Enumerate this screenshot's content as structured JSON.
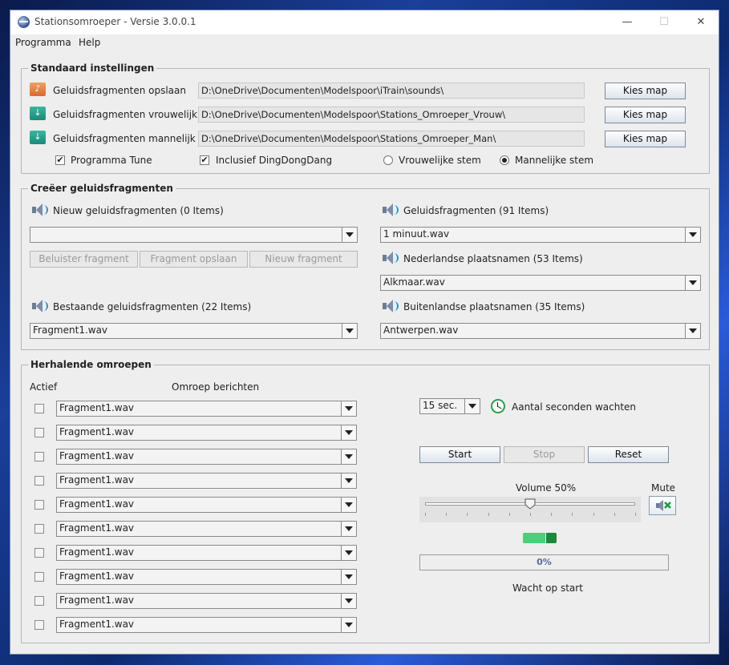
{
  "window": {
    "title": "Stationsomroeper - Versie 3.0.0.1",
    "controls": {
      "minimize": "—",
      "maximize": "☐",
      "close": "✕"
    }
  },
  "menu": [
    "Programma",
    "Help"
  ],
  "standaard": {
    "title": "Standaard instellingen",
    "rows": [
      {
        "label": "Geluidsfragmenten opslaan",
        "path": "D:\\OneDrive\\Documenten\\Modelspoor\\iTrain\\sounds\\",
        "button": "Kies map",
        "icon": "music-folder-icon"
      },
      {
        "label": "Geluidsfragmenten vrouwelijk",
        "path": "D:\\OneDrive\\Documenten\\Modelspoor\\Stations_Omroeper_Vrouw\\",
        "button": "Kies map",
        "icon": "download-folder-icon"
      },
      {
        "label": "Geluidsfragmenten mannelijk",
        "path": "D:\\OneDrive\\Documenten\\Modelspoor\\Stations_Omroeper_Man\\",
        "button": "Kies map",
        "icon": "download-folder-icon"
      }
    ],
    "programma_tune": "Programma Tune",
    "dingdongdang": "Inclusief DingDongDang",
    "vrouw": "Vrouwelijke stem",
    "man": "Mannelijke stem",
    "selected_voice": "man"
  },
  "creeer": {
    "title": "Creëer geluidsfragmenten",
    "nieuw_label": "Nieuw geluidsfragmenten (0 Items)",
    "nieuw_value": "",
    "btn_beluister": "Beluister fragment",
    "btn_opslaan": "Fragment opslaan",
    "btn_nieuw": "Nieuw fragment",
    "bestaande_label": "Bestaande geluidsfragmenten (22 Items)",
    "bestaande_value": "Fragment1.wav",
    "geluid_label": "Geluidsfragmenten (91 Items)",
    "geluid_value": "1 minuut.wav",
    "nl_label": "Nederlandse plaatsnamen (53 Items)",
    "nl_value": "Alkmaar.wav",
    "buiten_label": "Buitenlandse plaatsnamen (35 Items)",
    "buiten_value": "Antwerpen.wav"
  },
  "herhalend": {
    "title": "Herhalende omroepen",
    "actief_header": "Actief",
    "berichten_header": "Omroep berichten",
    "rows": [
      "Fragment1.wav",
      "Fragment1.wav",
      "Fragment1.wav",
      "Fragment1.wav",
      "Fragment1.wav",
      "Fragment1.wav",
      "Fragment1.wav",
      "Fragment1.wav",
      "Fragment1.wav",
      "Fragment1.wav"
    ],
    "seconds_value": "15 sec.",
    "seconds_label": "Aantal seconden wachten",
    "btn_start": "Start",
    "btn_stop": "Stop",
    "btn_reset": "Reset",
    "volume_label": "Volume 50%",
    "volume_value": 0.5,
    "mute_label": "Mute",
    "progress_text": "0%",
    "progress_value": 0,
    "status": "Wacht op start"
  }
}
